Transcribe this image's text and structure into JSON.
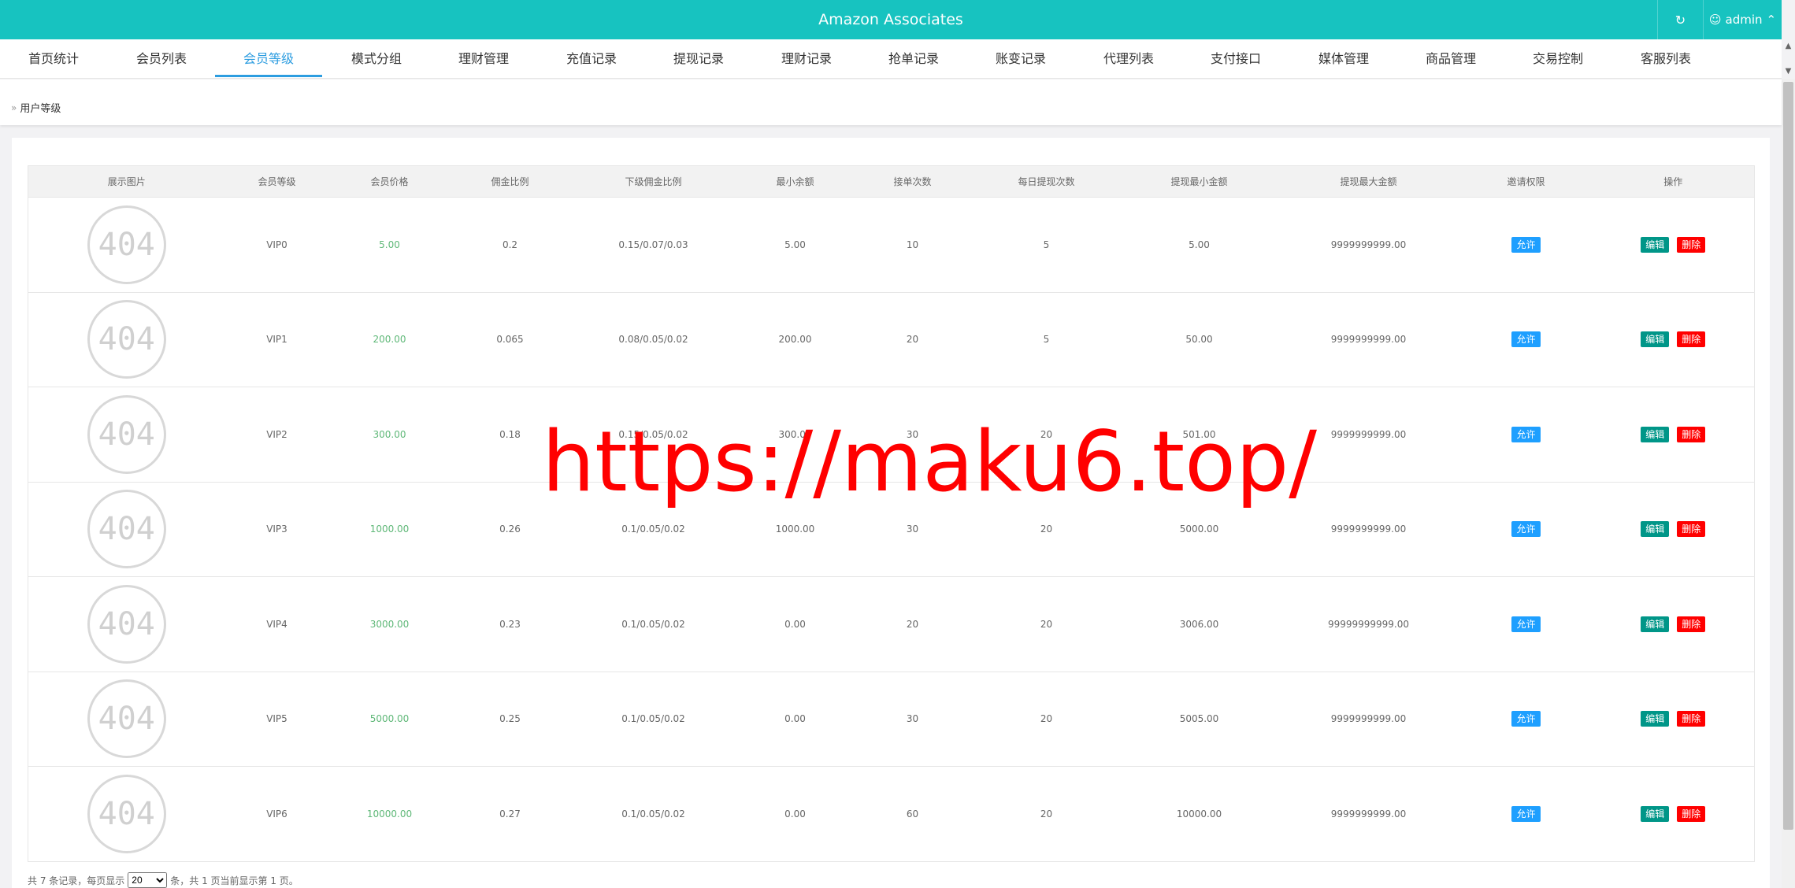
{
  "header": {
    "title": "Amazon Associates",
    "user": "admin"
  },
  "nav": [
    "首页统计",
    "会员列表",
    "会员等级",
    "模式分组",
    "理财管理",
    "充值记录",
    "提现记录",
    "理财记录",
    "抢单记录",
    "账变记录",
    "代理列表",
    "支付接口",
    "媒体管理",
    "商品管理",
    "交易控制",
    "客服列表"
  ],
  "nav_active": "会员等级",
  "breadcrumb": "用户等级",
  "table": {
    "headers": [
      "展示图片",
      "会员等级",
      "会员价格",
      "佣金比例",
      "下级佣金比例",
      "最小余额",
      "接单次数",
      "每日提现次数",
      "提现最小金额",
      "提现最大金额",
      "邀请权限",
      "操作"
    ],
    "image_placeholder": "404",
    "allow_label": "允许",
    "edit_label": "编辑",
    "delete_label": "删除",
    "rows": [
      {
        "level": "VIP0",
        "price": "5.00",
        "commission": "0.2",
        "sub_commission": "0.15/0.07/0.03",
        "min_balance": "5.00",
        "orders": "10",
        "daily_withdraw": "5",
        "withdraw_min": "5.00",
        "withdraw_max": "9999999999.00"
      },
      {
        "level": "VIP1",
        "price": "200.00",
        "commission": "0.065",
        "sub_commission": "0.08/0.05/0.02",
        "min_balance": "200.00",
        "orders": "20",
        "daily_withdraw": "5",
        "withdraw_min": "50.00",
        "withdraw_max": "9999999999.00"
      },
      {
        "level": "VIP2",
        "price": "300.00",
        "commission": "0.18",
        "sub_commission": "0.15/0.05/0.02",
        "min_balance": "300.00",
        "orders": "30",
        "daily_withdraw": "20",
        "withdraw_min": "501.00",
        "withdraw_max": "9999999999.00"
      },
      {
        "level": "VIP3",
        "price": "1000.00",
        "commission": "0.26",
        "sub_commission": "0.1/0.05/0.02",
        "min_balance": "1000.00",
        "orders": "30",
        "daily_withdraw": "20",
        "withdraw_min": "5000.00",
        "withdraw_max": "9999999999.00"
      },
      {
        "level": "VIP4",
        "price": "3000.00",
        "commission": "0.23",
        "sub_commission": "0.1/0.05/0.02",
        "min_balance": "0.00",
        "orders": "20",
        "daily_withdraw": "20",
        "withdraw_min": "3006.00",
        "withdraw_max": "99999999999.00"
      },
      {
        "level": "VIP5",
        "price": "5000.00",
        "commission": "0.25",
        "sub_commission": "0.1/0.05/0.02",
        "min_balance": "0.00",
        "orders": "30",
        "daily_withdraw": "20",
        "withdraw_min": "5005.00",
        "withdraw_max": "9999999999.00"
      },
      {
        "level": "VIP6",
        "price": "10000.00",
        "commission": "0.27",
        "sub_commission": "0.1/0.05/0.02",
        "min_balance": "0.00",
        "orders": "60",
        "daily_withdraw": "20",
        "withdraw_min": "10000.00",
        "withdraw_max": "9999999999.00"
      }
    ]
  },
  "watermark": "https://maku6.top/",
  "pager": {
    "prefix": "共 7 条记录，每页显示",
    "page_size": "20",
    "suffix": "条，共 1 页当前显示第 1 页。"
  },
  "colors": {
    "topbar": "#17c3c0",
    "accent": "#2d9de0",
    "price": "#5fb878",
    "allow": "#1e9fff",
    "edit": "#009688",
    "delete": "#ff0000",
    "watermark": "#ff0000"
  }
}
